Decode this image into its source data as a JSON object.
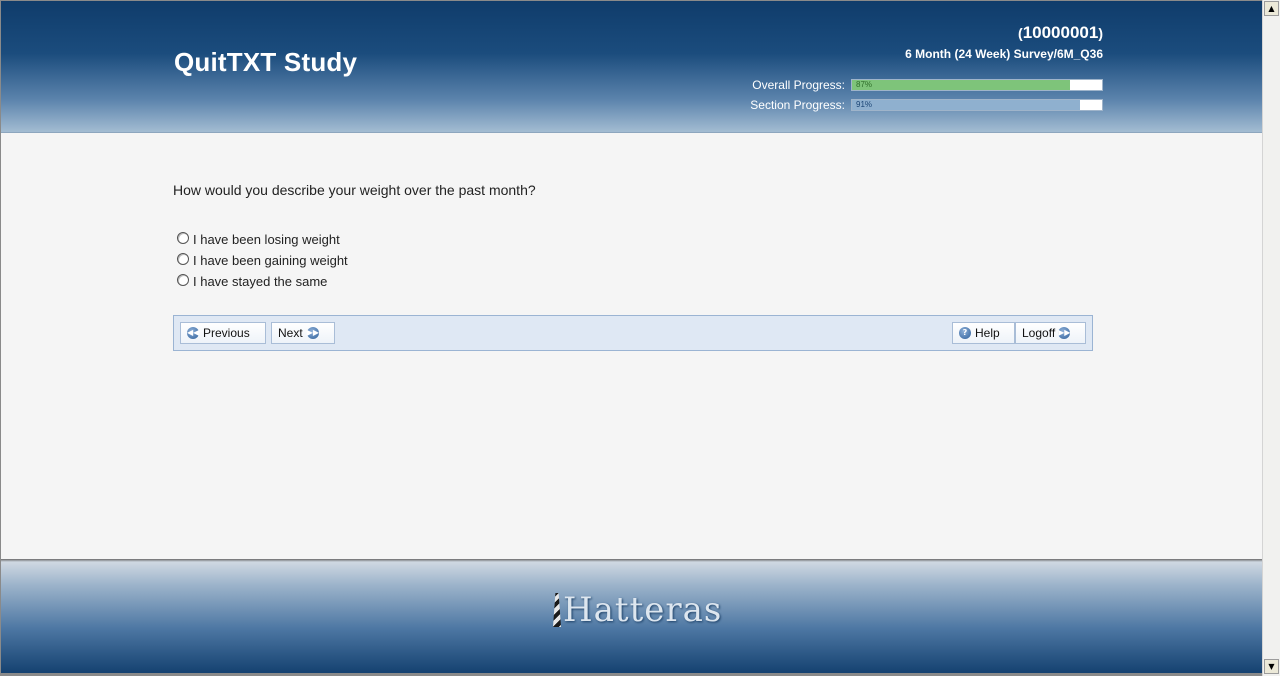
{
  "header": {
    "app_title": "QuitTXT Study",
    "user_id_open": "(",
    "user_id": "10000001",
    "user_id_close": ")",
    "survey_name": "6 Month (24 Week) Survey/6M_Q36",
    "overall_progress": {
      "label": "Overall Progress:",
      "percent_text": "87%",
      "value": 0.87
    },
    "section_progress": {
      "label": "Section Progress:",
      "percent_text": "91%",
      "value": 0.91
    }
  },
  "question": {
    "text": "How would you describe your weight over the past month?",
    "options": [
      {
        "label": "I have been losing weight",
        "selected": false
      },
      {
        "label": "I have been gaining weight",
        "selected": false
      },
      {
        "label": "I have stayed the same",
        "selected": false
      }
    ]
  },
  "nav": {
    "previous_label": "Previous",
    "next_label": "Next",
    "help_label": "Help",
    "logoff_label": "Logoff",
    "icons": {
      "previous": "rewind-circle-icon",
      "next": "fast-forward-circle-icon",
      "help": "question-circle-icon",
      "logoff": "fast-forward-circle-icon"
    }
  },
  "footer": {
    "logo_text": "Hatteras",
    "logo_icon": "lighthouse-icon"
  },
  "colors": {
    "header_dark": "#0f3c6b",
    "overall_fill": "#7ec47a",
    "section_fill": "#8fb0cf",
    "navbar_bg": "#dfe8f4"
  }
}
